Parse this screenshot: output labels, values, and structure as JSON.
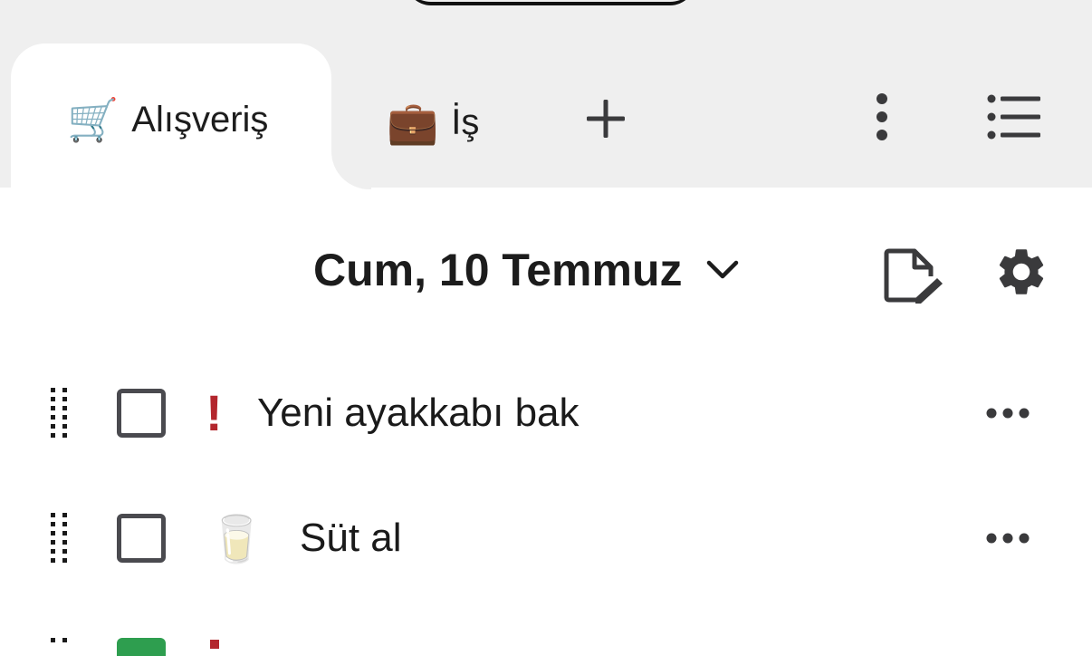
{
  "tabs": [
    {
      "emoji": "🛒",
      "label": "Alışveriş",
      "active": true,
      "icon": "shopping-cart-icon"
    },
    {
      "emoji": "💼",
      "label": "İş",
      "active": false,
      "icon": "briefcase-icon"
    }
  ],
  "toolbar_icons": [
    "plus-icon",
    "vertical-ellipsis-icon",
    "list-icon"
  ],
  "header": {
    "date": "Cum, 10 Temmuz",
    "icons": [
      "chevron-down-icon",
      "edit-note-icon",
      "gear-icon"
    ]
  },
  "tasks": [
    {
      "title": "Yeni ayakkabı bak",
      "checked": false,
      "marker": "!",
      "marker_type": "priority"
    },
    {
      "title": "Süt al",
      "checked": false,
      "marker": "🥛",
      "marker_type": "emoji"
    }
  ],
  "colors": {
    "tab_bar_bg": "#efefef",
    "priority": "#b3262d",
    "checkbox_border": "#4a4a4f",
    "checked_green": "#2e9e4f"
  }
}
